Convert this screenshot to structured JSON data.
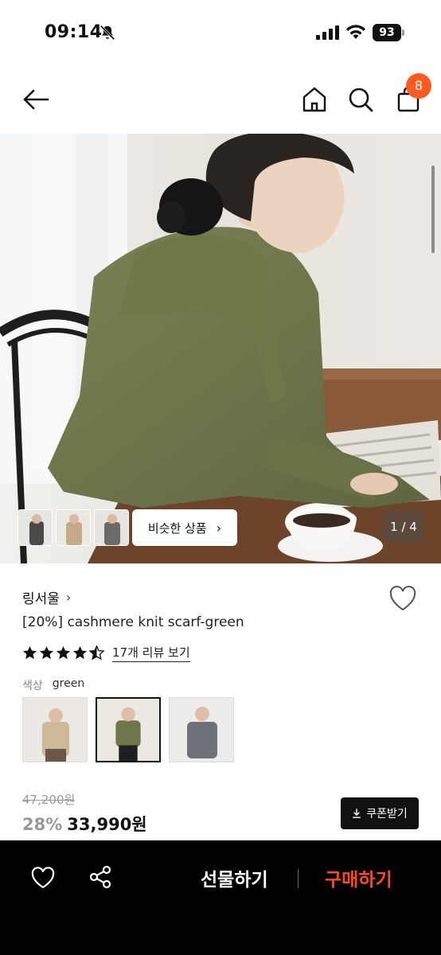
{
  "status_bar": {
    "time": "09:14",
    "battery": "93",
    "icons": [
      "bell-slash-icon",
      "signal-icon",
      "wifi-icon",
      "battery-icon"
    ]
  },
  "nav": {
    "icons": [
      "back-arrow-icon",
      "home-icon",
      "search-icon",
      "shopping-bag-icon"
    ],
    "cart_count": "8"
  },
  "gallery": {
    "similar_button": "비슷한 상품",
    "pager": "1 / 4"
  },
  "product": {
    "brand": "링서울",
    "title": "[20%] cashmere knit scarf-green",
    "rating": 4.5,
    "review_link": "17개 리뷰 보기",
    "color_label": "색상",
    "color_value": "green",
    "original_price": "47,200원",
    "discount": "28%",
    "price": "33,990원",
    "coupon_button": "쿠폰받기"
  },
  "bottom_bar": {
    "gift_button": "선물하기",
    "buy_button": "구매하기"
  },
  "colors": {
    "accent": "#ff5a1f",
    "buy": "#ff4a1c",
    "sweater": "#6b7248"
  }
}
